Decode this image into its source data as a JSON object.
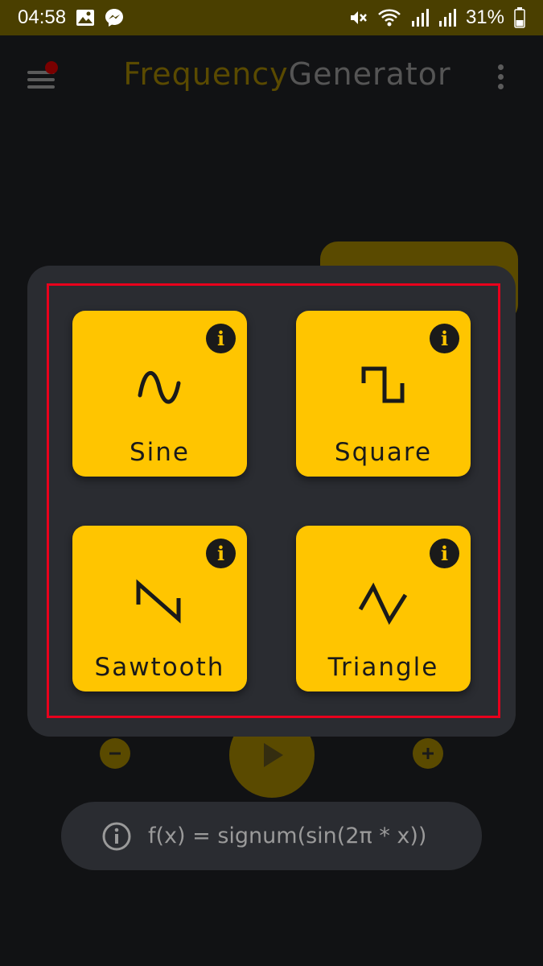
{
  "status_bar": {
    "time": "04:58",
    "battery": "31%",
    "left_icons": [
      "image-icon",
      "messenger-icon"
    ],
    "right_icons": [
      "mute-icon",
      "wifi-icon",
      "signal-icon",
      "signal-icon",
      "battery-icon"
    ]
  },
  "app_bar": {
    "title_part1": "Frequency",
    "title_part2": "Generator"
  },
  "waveform_dialog": {
    "options": [
      {
        "label": "Sine",
        "icon": "sine-wave-icon"
      },
      {
        "label": "Square",
        "icon": "square-wave-icon"
      },
      {
        "label": "Sawtooth",
        "icon": "sawtooth-wave-icon"
      },
      {
        "label": "Triangle",
        "icon": "triangle-wave-icon"
      }
    ]
  },
  "formula": {
    "text": "f(x) = signum(sin(2π * x))"
  },
  "colors": {
    "accent": "#ffc500",
    "dialog_bg": "#2a2c31",
    "background": "#111214",
    "highlight": "#e8001c"
  }
}
